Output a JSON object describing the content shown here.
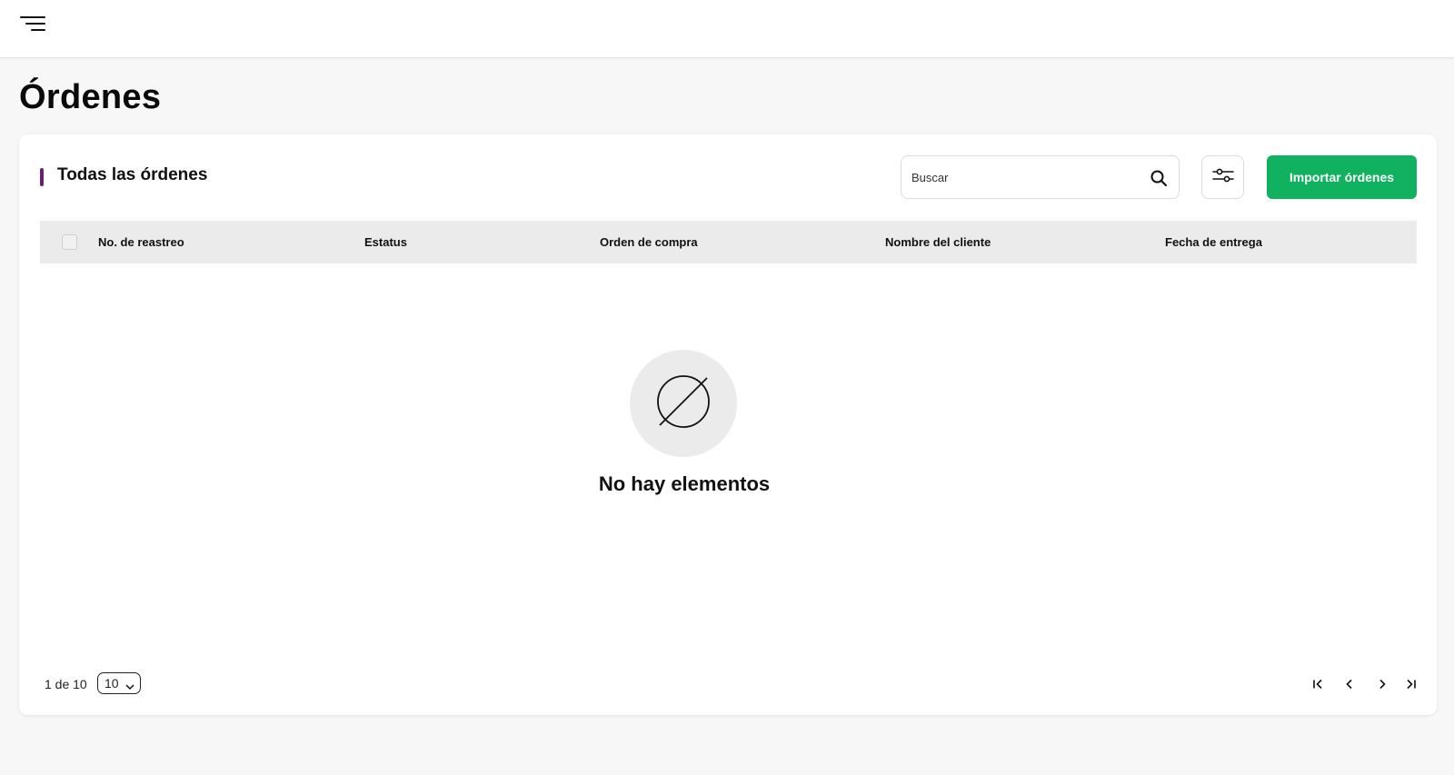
{
  "header": {
    "menu_icon": "menu-lines-icon"
  },
  "page": {
    "title": "Órdenes"
  },
  "card": {
    "title": "Todas las órdenes",
    "accent_color": "#6b1f6e",
    "search": {
      "placeholder": "Buscar",
      "value": "",
      "icon": "search-icon"
    },
    "filter_icon": "sliders-icon",
    "import_label": "Importar órdenes",
    "import_color": "#10b25f"
  },
  "table": {
    "columns": [
      "No. de reastreo",
      "Estatus",
      "Orden de compra",
      "Nombre del cliente",
      "Fecha de entrega"
    ]
  },
  "empty_state": {
    "icon": "empty-set-icon",
    "message": "No hay elementos"
  },
  "pagination": {
    "info": "1 de 10",
    "page_size": "10",
    "icons": [
      "first-page-icon",
      "prev-page-icon",
      "next-page-icon",
      "last-page-icon"
    ]
  }
}
